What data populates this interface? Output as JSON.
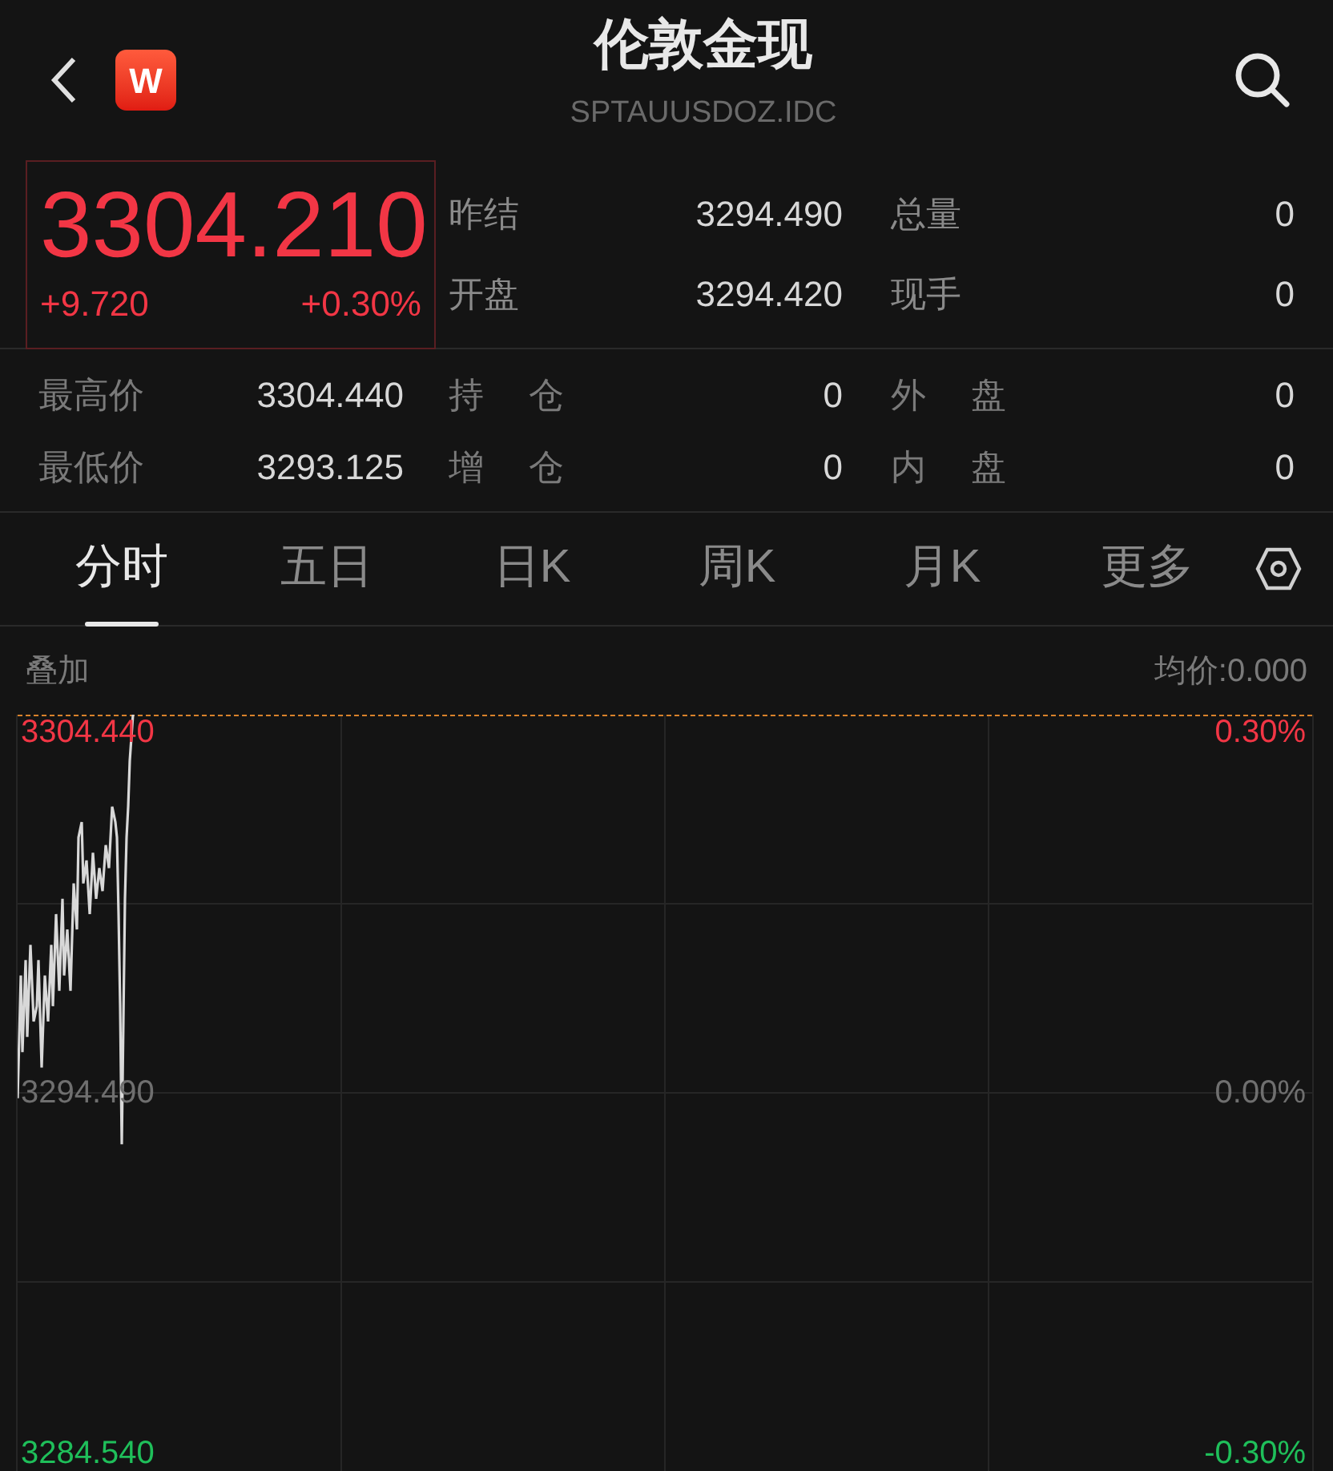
{
  "header": {
    "title": "伦敦金现",
    "symbol": "SPTAUUSDOZ.IDC",
    "logo": "W"
  },
  "quote": {
    "price": "3304.210",
    "change": "+9.720",
    "change_pct": "+0.30%"
  },
  "top_stats": [
    [
      {
        "label": "昨结",
        "value": "3294.490"
      },
      {
        "label": "总量",
        "value": "0"
      }
    ],
    [
      {
        "label": "开盘",
        "value": "3294.420"
      },
      {
        "label": "现手",
        "value": "0"
      }
    ]
  ],
  "bottom_stats": [
    [
      {
        "label": "最高价",
        "value": "3304.440"
      },
      {
        "label": "持 仓",
        "value": "0"
      },
      {
        "label": "外 盘",
        "value": "0"
      }
    ],
    [
      {
        "label": "最低价",
        "value": "3293.125"
      },
      {
        "label": "增 仓",
        "value": "0"
      },
      {
        "label": "内 盘",
        "value": "0"
      }
    ]
  ],
  "tabs": [
    {
      "label": "分时",
      "selected": true
    },
    {
      "label": "五日",
      "selected": false
    },
    {
      "label": "日K",
      "selected": false
    },
    {
      "label": "周K",
      "selected": false
    },
    {
      "label": "月K",
      "selected": false
    },
    {
      "label": "更多",
      "selected": false
    }
  ],
  "chart": {
    "overlay_label": "叠加",
    "avg_price": "均价:0.000",
    "axis_left": [
      {
        "text": "3304.440",
        "kind": "up"
      },
      {
        "text": "3294.490",
        "kind": "flat"
      },
      {
        "text": "3284.540",
        "kind": "down"
      }
    ],
    "axis_right": [
      {
        "text": "0.30%",
        "kind": "up"
      },
      {
        "text": "0.00%",
        "kind": "flat"
      },
      {
        "text": "-0.30%",
        "kind": "down"
      }
    ]
  }
}
